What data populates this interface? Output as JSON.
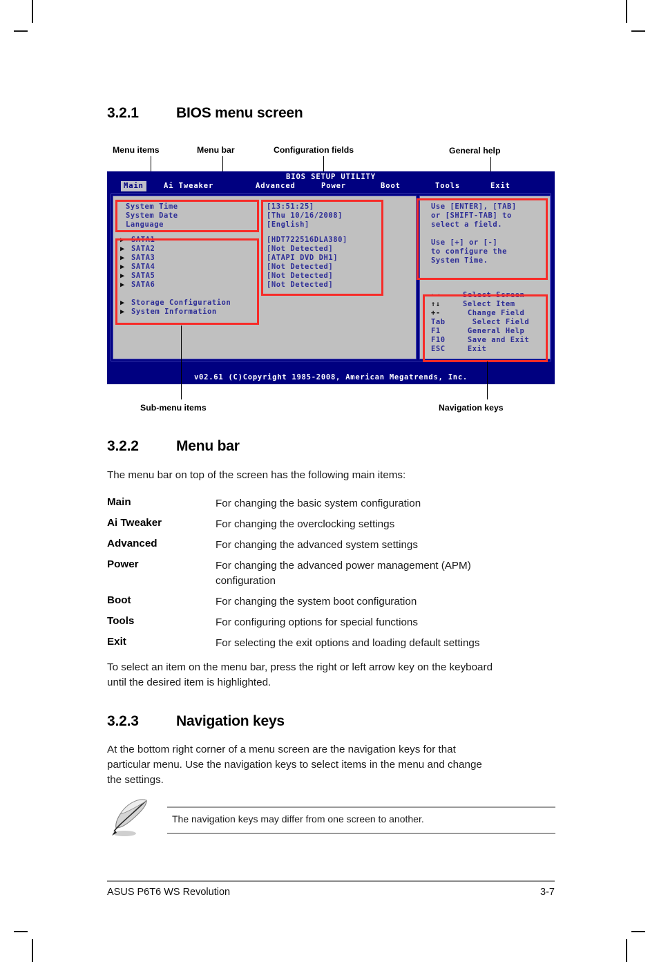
{
  "document": {
    "footer_left": "ASUS P6T6 WS Revolution",
    "footer_page": "3-7"
  },
  "sections": {
    "s321": {
      "number": "3.2.1",
      "title": "BIOS menu screen"
    },
    "s322": {
      "number": "3.2.2",
      "title": "Menu bar"
    },
    "s323": {
      "number": "3.2.3",
      "title": "Navigation keys"
    }
  },
  "figure": {
    "callouts": {
      "menu_items": "Menu items",
      "menu_bar": "Menu bar",
      "configuration_fields": "Configuration fields",
      "general_help": "General help",
      "sub_menu_items": "Sub-menu items",
      "navigation_keys": "Navigation keys"
    },
    "bios": {
      "title": "BIOS SETUP UTILITY",
      "tabs": [
        {
          "label": "Main",
          "active": true
        },
        {
          "label": "Ai Tweaker",
          "active": false
        },
        {
          "label": "Advanced",
          "active": false
        },
        {
          "label": "Power",
          "active": false
        },
        {
          "label": "Boot",
          "active": false
        },
        {
          "label": "Tools",
          "active": false
        },
        {
          "label": "Exit",
          "active": false
        }
      ],
      "menu_items": [
        "System Time",
        "System Date",
        "Language"
      ],
      "config_values_top": [
        "[13:51:25]",
        "[Thu 10/16/2008]",
        "[English]"
      ],
      "submenu_items": [
        "SATA1",
        "SATA2",
        "SATA3",
        "SATA4",
        "SATA5",
        "SATA6"
      ],
      "config_values_sata": [
        "[HDT722516DLA380]",
        "[Not Detected]",
        "[ATAPI DVD DH1]",
        "[Not Detected]",
        "[Not Detected]",
        "[Not Detected]"
      ],
      "submenu_items2": [
        "Storage Configuration",
        "System Information"
      ],
      "general_help": [
        "Use [ENTER], [TAB]",
        "or [SHIFT-TAB] to",
        "select a field.",
        "",
        "Use [+] or [-]",
        "to configure the",
        "System Time."
      ],
      "navigation_keys": [
        {
          "key": "←→",
          "action": "Select Screen"
        },
        {
          "key": "↑↓",
          "action": "Select Item"
        },
        {
          "key": "+-",
          "action": " Change Field"
        },
        {
          "key": "Tab",
          "action": "  Select Field"
        },
        {
          "key": "F1",
          "action": " General Help"
        },
        {
          "key": "F10",
          "action": " Save and Exit"
        },
        {
          "key": "ESC",
          "action": " Exit"
        }
      ],
      "copyright": "v02.61 (C)Copyright 1985-2008, American Megatrends, Inc.",
      "colors": {
        "chrome": "#000080",
        "pane": "#c0c0c0",
        "text": "#2d2d96",
        "annotation": "#f72b28",
        "tab_active_bg": "#c0c0c8"
      }
    }
  },
  "menu_bar_section": {
    "intro": "The menu bar on top of the screen has the following main items:",
    "items": [
      {
        "term": "Main",
        "definition": "For changing the basic system configuration"
      },
      {
        "term": "Ai Tweaker",
        "definition": "For changing the overclocking settings"
      },
      {
        "term": "Advanced",
        "definition": "For changing the advanced system settings"
      },
      {
        "term": "Power",
        "definition": "For changing the advanced power management (APM)",
        "definition2": "configuration"
      },
      {
        "term": "Boot",
        "definition": "For changing the system boot configuration"
      },
      {
        "term": "Tools",
        "definition": "For configuring options for special functions"
      },
      {
        "term": "Exit",
        "definition": "For selecting the exit options and loading default settings"
      }
    ],
    "outro_line1": "To select an item on the menu bar, press the right or left arrow key on the keyboard",
    "outro_line2": "until the desired item is highlighted."
  },
  "navigation_keys_section": {
    "body_line1": "At the bottom right corner of a menu screen are the navigation keys for that",
    "body_line2": "particular menu. Use the navigation keys to select items in the menu and change",
    "body_line3": "the settings.",
    "note": "The navigation keys may differ from one screen to another."
  }
}
